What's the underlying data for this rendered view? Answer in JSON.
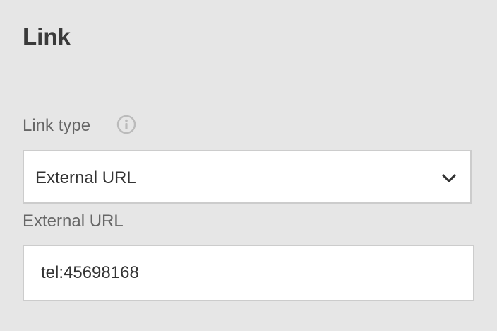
{
  "section": {
    "title": "Link"
  },
  "link_type": {
    "label": "Link type",
    "info_icon": "info-circle-icon",
    "selected_value": "External URL",
    "dropdown_icon": "chevron-down-icon"
  },
  "external_url": {
    "label": "External URL",
    "value": "tel:45698168"
  },
  "colors": {
    "background": "#e6e6e6",
    "field_background": "#ffffff",
    "field_border": "#cccccc",
    "label_text": "#666666",
    "title_text": "#3a3a3a",
    "info_icon": "#bbbbbb"
  }
}
